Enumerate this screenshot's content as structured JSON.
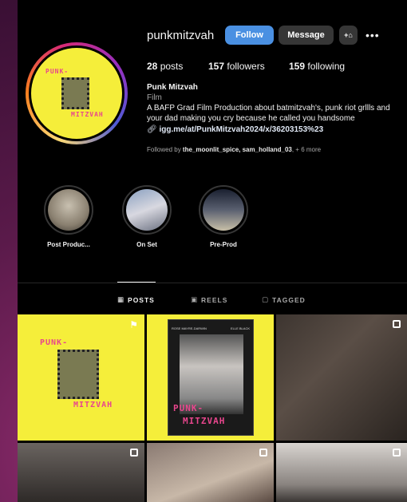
{
  "profile": {
    "username": "punkmitzvah",
    "follow_label": "Follow",
    "message_label": "Message",
    "add_user_glyph": "+⌂",
    "more_glyph": "•••",
    "posts_count": "28",
    "posts_label": "posts",
    "followers_count": "157",
    "followers_label": "followers",
    "following_count": "159",
    "following_label": "following",
    "name": "Punk Mitzvah",
    "category": "Film",
    "bio": "A BAFP Grad Film Production about batmitzvah's, punk riot grllls and your dad making you cry because he called you handsome",
    "link": "igg.me/at/PunkMitzvah2024/x/36203153%23",
    "followed_by_prefix": "Followed by ",
    "followed_by_names": "the_moonlit_spice, sam_holland_03",
    "followed_by_suffix": ", + 6 more"
  },
  "avatar": {
    "logo_top": "PUNK-",
    "logo_bottom": "MITZVAH"
  },
  "highlights": [
    {
      "label": "Post Produc..."
    },
    {
      "label": "On Set"
    },
    {
      "label": "Pre-Prod"
    }
  ],
  "tabs": [
    {
      "label": "POSTS",
      "icon": "grid-icon",
      "active": true
    },
    {
      "label": "REELS",
      "icon": "reels-icon",
      "active": false
    },
    {
      "label": "TAGGED",
      "icon": "tagged-icon",
      "active": false
    }
  ],
  "grid": {
    "post1_top": "PUNK-",
    "post1_bottom": "MITZVAH",
    "post2_title_line1": "PUNK-",
    "post2_title_line2": "MITZVAH",
    "post2_credit_left": "ROSE MAYRE-DARWIN",
    "post2_credit_right": "ELLE BLACK"
  },
  "colors": {
    "follow_button": "#4a90e2",
    "brand_yellow": "#f5ee3a",
    "brand_pink": "#e8468d"
  }
}
